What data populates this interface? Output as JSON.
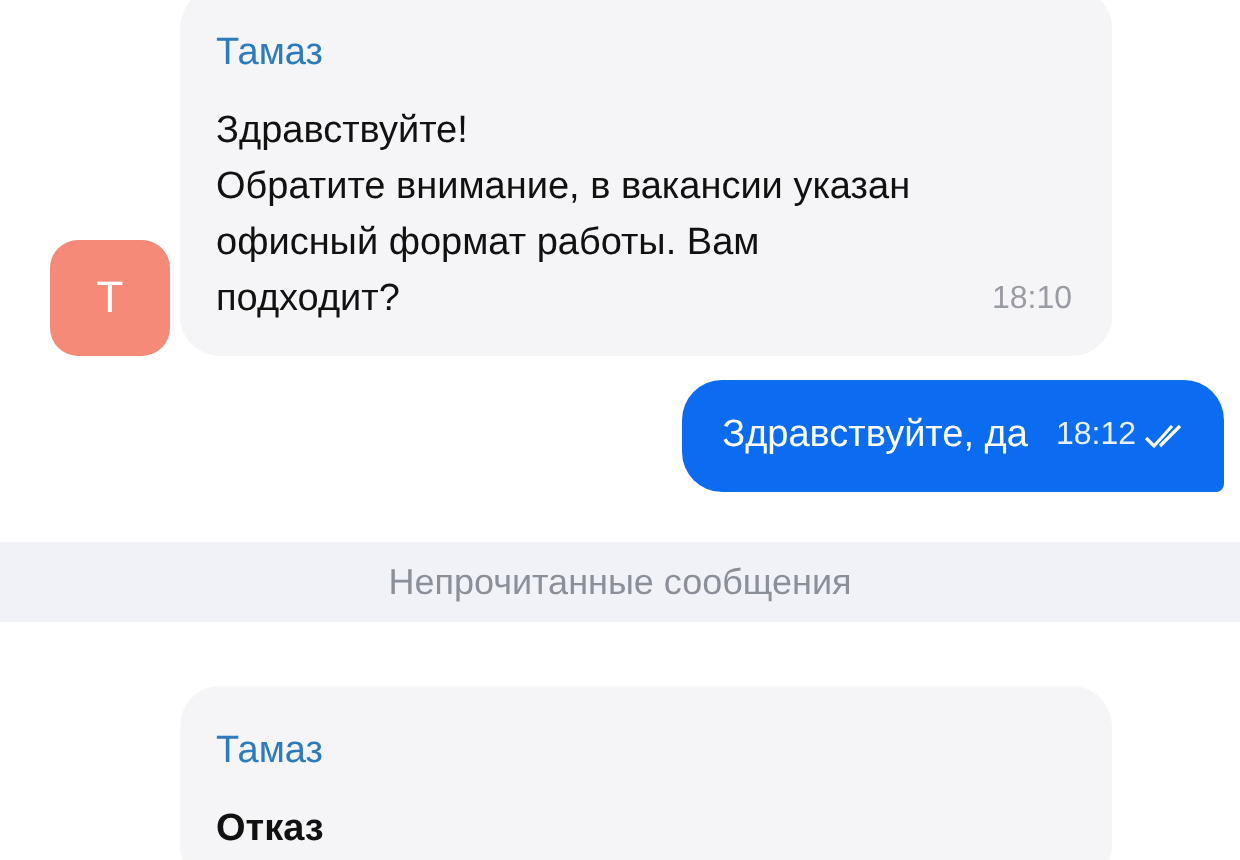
{
  "messages": [
    {
      "kind": "incoming",
      "sender": "Тамаз",
      "avatar": "Т",
      "color": "#f58a78",
      "text": "Здравствуйте!\nОбратите внимание, в вакансии указан офисный формат работы. Вам подходит?",
      "bold": false,
      "time": "18:10"
    },
    {
      "kind": "outgoing",
      "text": "Здравствуйте, да",
      "time": "18:12",
      "read": true
    },
    {
      "kind": "divider",
      "text": "Непрочитанные сообщения"
    },
    {
      "kind": "incoming",
      "sender": "Тамаз",
      "text": "Отказ",
      "bold": true
    }
  ]
}
